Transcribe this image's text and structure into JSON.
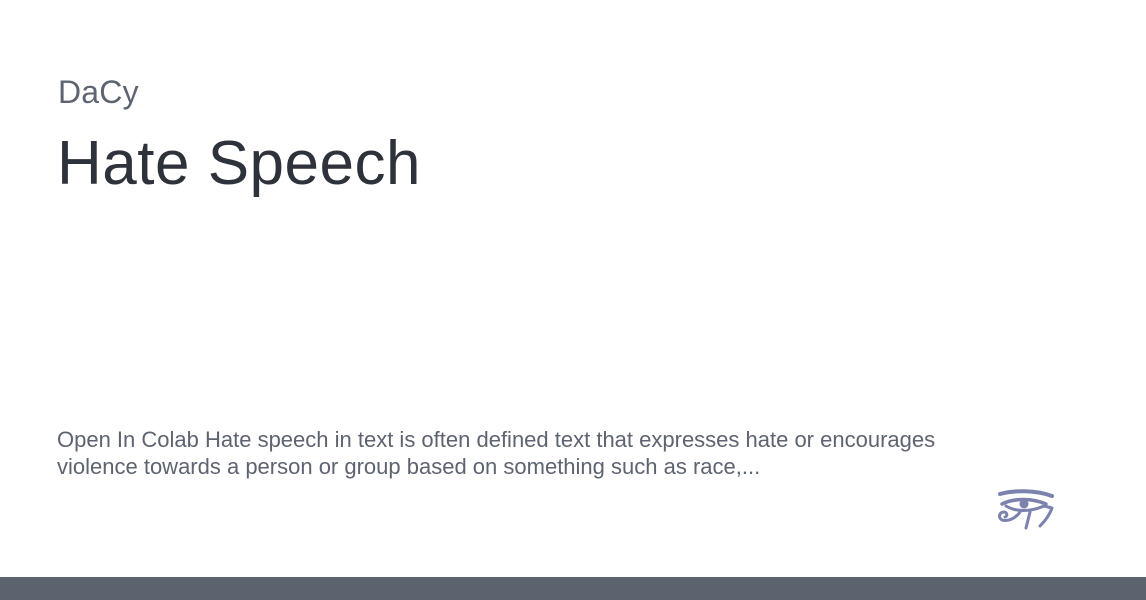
{
  "site": {
    "name": "DaCy"
  },
  "page": {
    "title": "Hate Speech",
    "description": "Open In Colab Hate speech in text is often defined text that expresses hate or encourages violence towards a person or group based on something such as race,..."
  },
  "logo": {
    "icon": "eye-of-horus-icon",
    "color": "#7a82ad"
  },
  "theme": {
    "background": "#ffffff",
    "title_color": "#2e323a",
    "muted_text_color": "#5d6470",
    "footer_bar_color": "#5c626e"
  }
}
